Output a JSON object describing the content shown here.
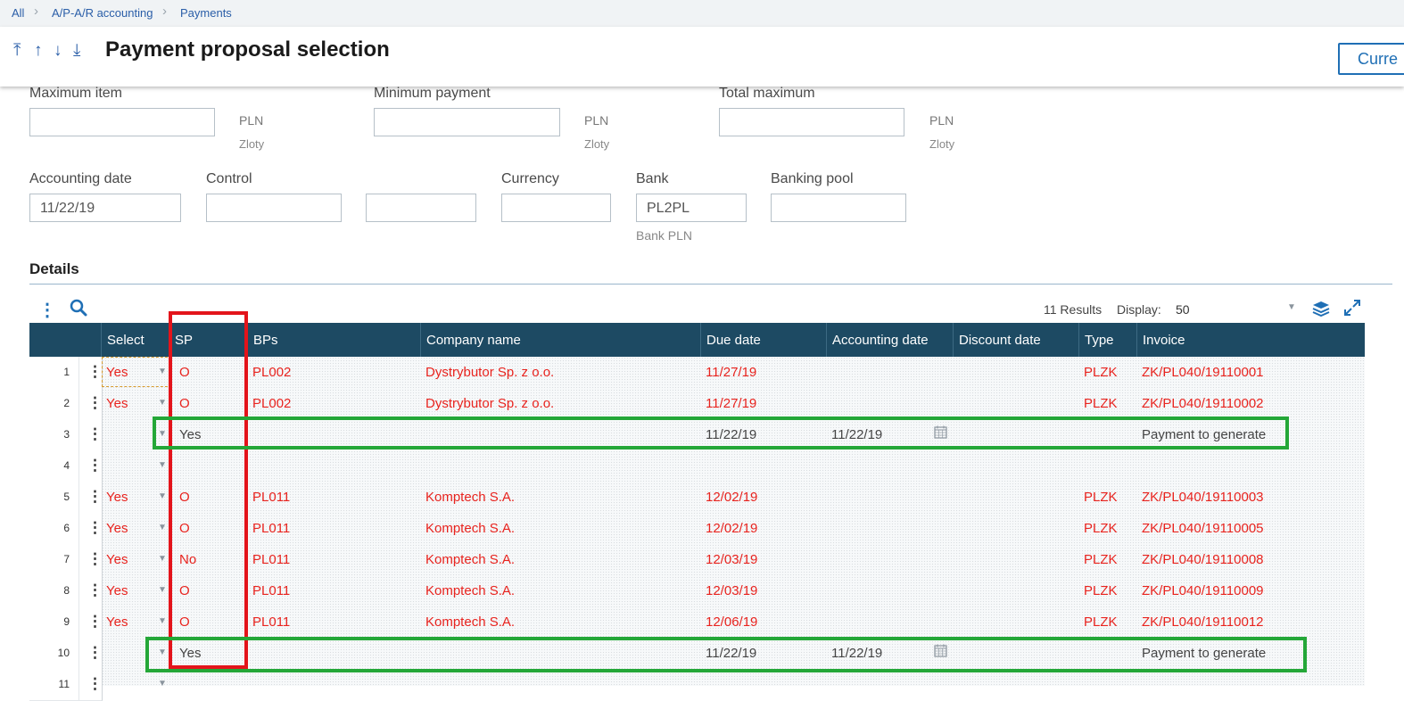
{
  "breadcrumb": {
    "items": [
      "All",
      "A/P-A/R accounting",
      "Payments"
    ]
  },
  "header": {
    "title": "Payment proposal selection",
    "current_button": "Curre"
  },
  "form": {
    "maximum_item": {
      "label": "Maximum item",
      "value": "",
      "unit": "PLN",
      "unit_name": "Zloty"
    },
    "minimum_payment": {
      "label": "Minimum payment",
      "value": "",
      "unit": "PLN",
      "unit_name": "Zloty"
    },
    "total_maximum": {
      "label": "Total maximum",
      "value": "",
      "unit": "PLN",
      "unit_name": "Zloty"
    },
    "accounting_date": {
      "label": "Accounting date",
      "value": "11/22/19"
    },
    "control": {
      "label": "Control",
      "value": "",
      "value2": ""
    },
    "currency": {
      "label": "Currency",
      "value": ""
    },
    "bank": {
      "label": "Bank",
      "value": "PL2PL",
      "desc": "Bank PLN"
    },
    "banking_pool": {
      "label": "Banking pool",
      "value": ""
    }
  },
  "details": {
    "title": "Details",
    "results": "11 Results",
    "display_label": "Display:",
    "display_value": "50",
    "icons": [
      "more-vert-icon",
      "search-icon",
      "layers-icon",
      "expand-icon"
    ],
    "columns": [
      "Select",
      "SP",
      "BPs",
      "Company name",
      "Due date",
      "Accounting date",
      "Discount date",
      "Type",
      "Invoice"
    ],
    "rows": [
      {
        "num": "1",
        "select": "Yes",
        "sp": "O",
        "bps": "PL002",
        "company": "Dystrybutor Sp. z o.o.",
        "due": "11/27/19",
        "acc": "",
        "disc": "",
        "type": "PLZK",
        "invoice": "ZK/PL040/19110001"
      },
      {
        "num": "2",
        "select": "Yes",
        "sp": "O",
        "bps": "PL002",
        "company": "Dystrybutor Sp. z o.o.",
        "due": "11/27/19",
        "acc": "",
        "disc": "",
        "type": "PLZK",
        "invoice": "ZK/PL040/19110002"
      },
      {
        "num": "3",
        "select": "",
        "sp": "Yes",
        "bps": "",
        "company": "",
        "due": "11/22/19",
        "acc": "11/22/19",
        "disc": "",
        "type": "",
        "invoice": "Payment to generate"
      },
      {
        "num": "4",
        "select": "",
        "sp": "",
        "bps": "",
        "company": "",
        "due": "",
        "acc": "",
        "disc": "",
        "type": "",
        "invoice": ""
      },
      {
        "num": "5",
        "select": "Yes",
        "sp": "O",
        "bps": "PL011",
        "company": "Komptech S.A.",
        "due": "12/02/19",
        "acc": "",
        "disc": "",
        "type": "PLZK",
        "invoice": "ZK/PL040/19110003"
      },
      {
        "num": "6",
        "select": "Yes",
        "sp": "O",
        "bps": "PL011",
        "company": "Komptech S.A.",
        "due": "12/02/19",
        "acc": "",
        "disc": "",
        "type": "PLZK",
        "invoice": "ZK/PL040/19110005"
      },
      {
        "num": "7",
        "select": "Yes",
        "sp": "No",
        "bps": "PL011",
        "company": "Komptech S.A.",
        "due": "12/03/19",
        "acc": "",
        "disc": "",
        "type": "PLZK",
        "invoice": "ZK/PL040/19110008"
      },
      {
        "num": "8",
        "select": "Yes",
        "sp": "O",
        "bps": "PL011",
        "company": "Komptech S.A.",
        "due": "12/03/19",
        "acc": "",
        "disc": "",
        "type": "PLZK",
        "invoice": "ZK/PL040/19110009"
      },
      {
        "num": "9",
        "select": "Yes",
        "sp": "O",
        "bps": "PL011",
        "company": "Komptech S.A.",
        "due": "12/06/19",
        "acc": "",
        "disc": "",
        "type": "PLZK",
        "invoice": "ZK/PL040/19110012"
      },
      {
        "num": "10",
        "select": "",
        "sp": "Yes",
        "bps": "",
        "company": "",
        "due": "11/22/19",
        "acc": "11/22/19",
        "disc": "",
        "type": "",
        "invoice": "Payment to generate"
      },
      {
        "num": "11",
        "select": "",
        "sp": "",
        "bps": "",
        "company": "",
        "due": "",
        "acc": "",
        "disc": "",
        "type": "",
        "invoice": ""
      }
    ]
  },
  "colors": {
    "header_bg": "#1d4a63",
    "accent": "#1f6fb5",
    "red_text": "#e8231e",
    "highlight_red": "#e3141b",
    "highlight_green": "#24a738"
  }
}
